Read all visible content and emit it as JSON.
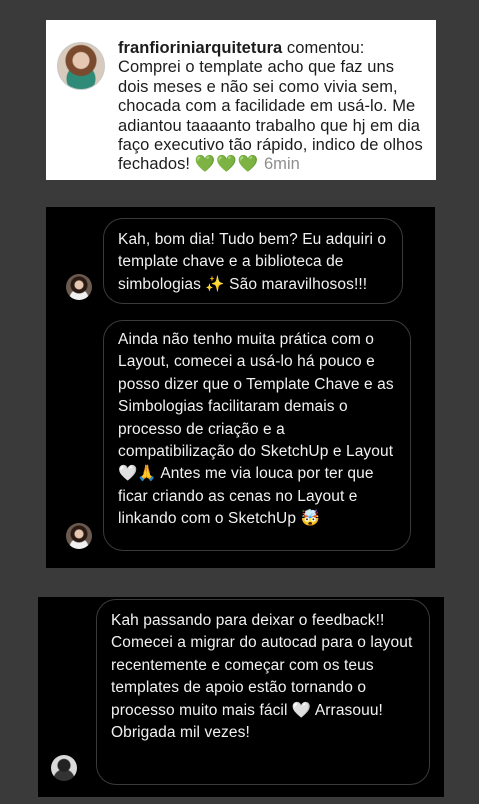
{
  "comment": {
    "username": "franfioriniarquitetura",
    "action": "comentou:",
    "text": "Comprei o template acho que faz uns dois meses e não sei como vivia sem, chocada com a facilidade em usá-lo. Me adiantou taaaanto trabalho que hj em dia faço executivo tão rápido, indico de olhos fechados!",
    "emojis": "💚💚💚",
    "time": "6min",
    "avatar_icon": "profile-avatar"
  },
  "dm1": {
    "message_1": "Kah, bom dia! Tudo bem? Eu adquiri o template chave e a biblioteca de simbologias ✨ São maravilhosos!!!",
    "message_2": "Ainda não tenho muita prática com o Layout, comecei a usá-lo há pouco e posso dizer que o Template Chave e as Simbologias facilitaram demais o processo de criação e a compatibilização do SketchUp e Layout 🤍🙏 Antes me via louca por ter que ficar criando as cenas no Layout e linkando com o SketchUp 🤯",
    "avatar_icon": "profile-avatar"
  },
  "dm2": {
    "message": "Kah passando para deixar o feedback!! Comecei a migrar do autocad para o layout recentemente e começar com os teus templates de apoio estão tornando o processo muito mais fácil 🤍 Arrasouu! Obrigada mil vezes!",
    "avatar_icon": "profile-avatar"
  },
  "colors": {
    "page_background": "#3a3a3a",
    "dm_background": "#000000",
    "bubble_border": "#3a3a3a",
    "heart_green": "#3fbf3f",
    "timestamp_grey": "#8e8e8e"
  }
}
